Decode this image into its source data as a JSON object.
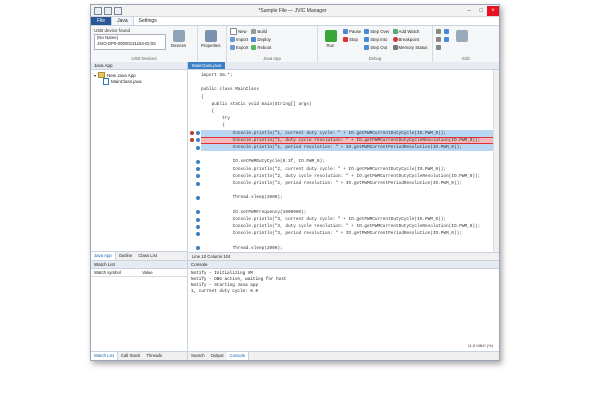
{
  "window": {
    "title": "*Sample File — JVIC Manager"
  },
  "ribbon_tabs": [
    "File",
    "Java",
    "Settings"
  ],
  "usb": {
    "label": "USB device found",
    "device_name": "(No Name)",
    "device_id": "JSIO-DP0-00000131163-ID:0S",
    "group": "USB Devices"
  },
  "devices_btns": [
    "Devices",
    "Properties"
  ],
  "javaapp": {
    "items": [
      "New",
      "Import",
      "Export"
    ],
    "items2": [
      "Build",
      "Deploy",
      "Reboot"
    ],
    "group": "Java App"
  },
  "run": {
    "label": "Run"
  },
  "debug": {
    "items": [
      "Pause",
      "Stop"
    ],
    "steps": [
      "Step Over",
      "Step Into",
      "Step Out"
    ],
    "group": "Debug"
  },
  "watch": {
    "items": [
      "Add Watch",
      "Breakpoint",
      "Memory Status"
    ]
  },
  "edit_group": "Edit",
  "editor": {
    "tab": "MainClass.java",
    "lines": [
      "import Sm.*;",
      "",
      "public class MainClass",
      "{",
      "    public static void main(String[] args)",
      "    {",
      "        try",
      "        {",
      "            Console.println(\"1, current duty cycle: \" + IO.getPWMCurrentDutyCycle(IO.PWM_0));",
      "            Console.println(\"1, duty cycle resolution: \" + IO.getPWMCurrentDutyCycleResolution(IO.PWM_0));",
      "            Console.println(\"1, period resolution: \" + IO.getPWMCurrentPeriodResolution(IO.PWM_0));",
      "",
      "            IO.setPWMDutyCycle(0.3f, IO.PWM_0);",
      "            Console.println(\"2, current duty cycle: \" + IO.getPWMCurrentDutyCycle(IO.PWM_0));",
      "            Console.println(\"2, duty cycle resolution: \" + IO.getPWMCurrentDutyCycleResolution(IO.PWM_0));",
      "            Console.println(\"2, period resolution: \" + IO.getPWMCurrentPeriodResolution(IO.PWM_0));",
      "",
      "            Thread.sleep(2000);",
      "",
      "            IO.setPWMFrequency(1000000);",
      "            Console.println(\"3, current duty cycle: \" + IO.getPWMCurrentDutyCycle(IO.PWM_0));",
      "            Console.println(\"3, duty cycle resolution: \" + IO.getPWMCurrentDutyCycleResolution(IO.PWM_0));",
      "            Console.println(\"3, period resolution: \" + IO.getPWMCurrentPeriodResolution(IO.PWM_0));",
      "",
      "            Thread.sleep(2000);"
    ],
    "status": "Line 10 Column 104"
  },
  "left_panel": {
    "title": "Java App",
    "tree": [
      "New Java App",
      "MainClass.java"
    ],
    "tabs": [
      "Java App",
      "Outline",
      "Class List"
    ]
  },
  "watch_list": {
    "title": "Watch List",
    "col1": "Watch symbol",
    "col2": "Value",
    "tabs": [
      "Watch List",
      "Call Stack",
      "Threads"
    ]
  },
  "console": {
    "title": "Console",
    "lines": [
      "Notify - Initializing VM",
      "Notify - DBG active, waiting for host",
      "Notify - Starting Java app",
      "1, current duty cycle: 0.0"
    ],
    "memory": "11,8 MB/0 (%)",
    "tabs": [
      "Search",
      "Output",
      "Console"
    ]
  },
  "colors": {
    "accent": "#2b5797",
    "highlight": "#b9d6f2",
    "breakpoint": "#f2b8bc"
  }
}
